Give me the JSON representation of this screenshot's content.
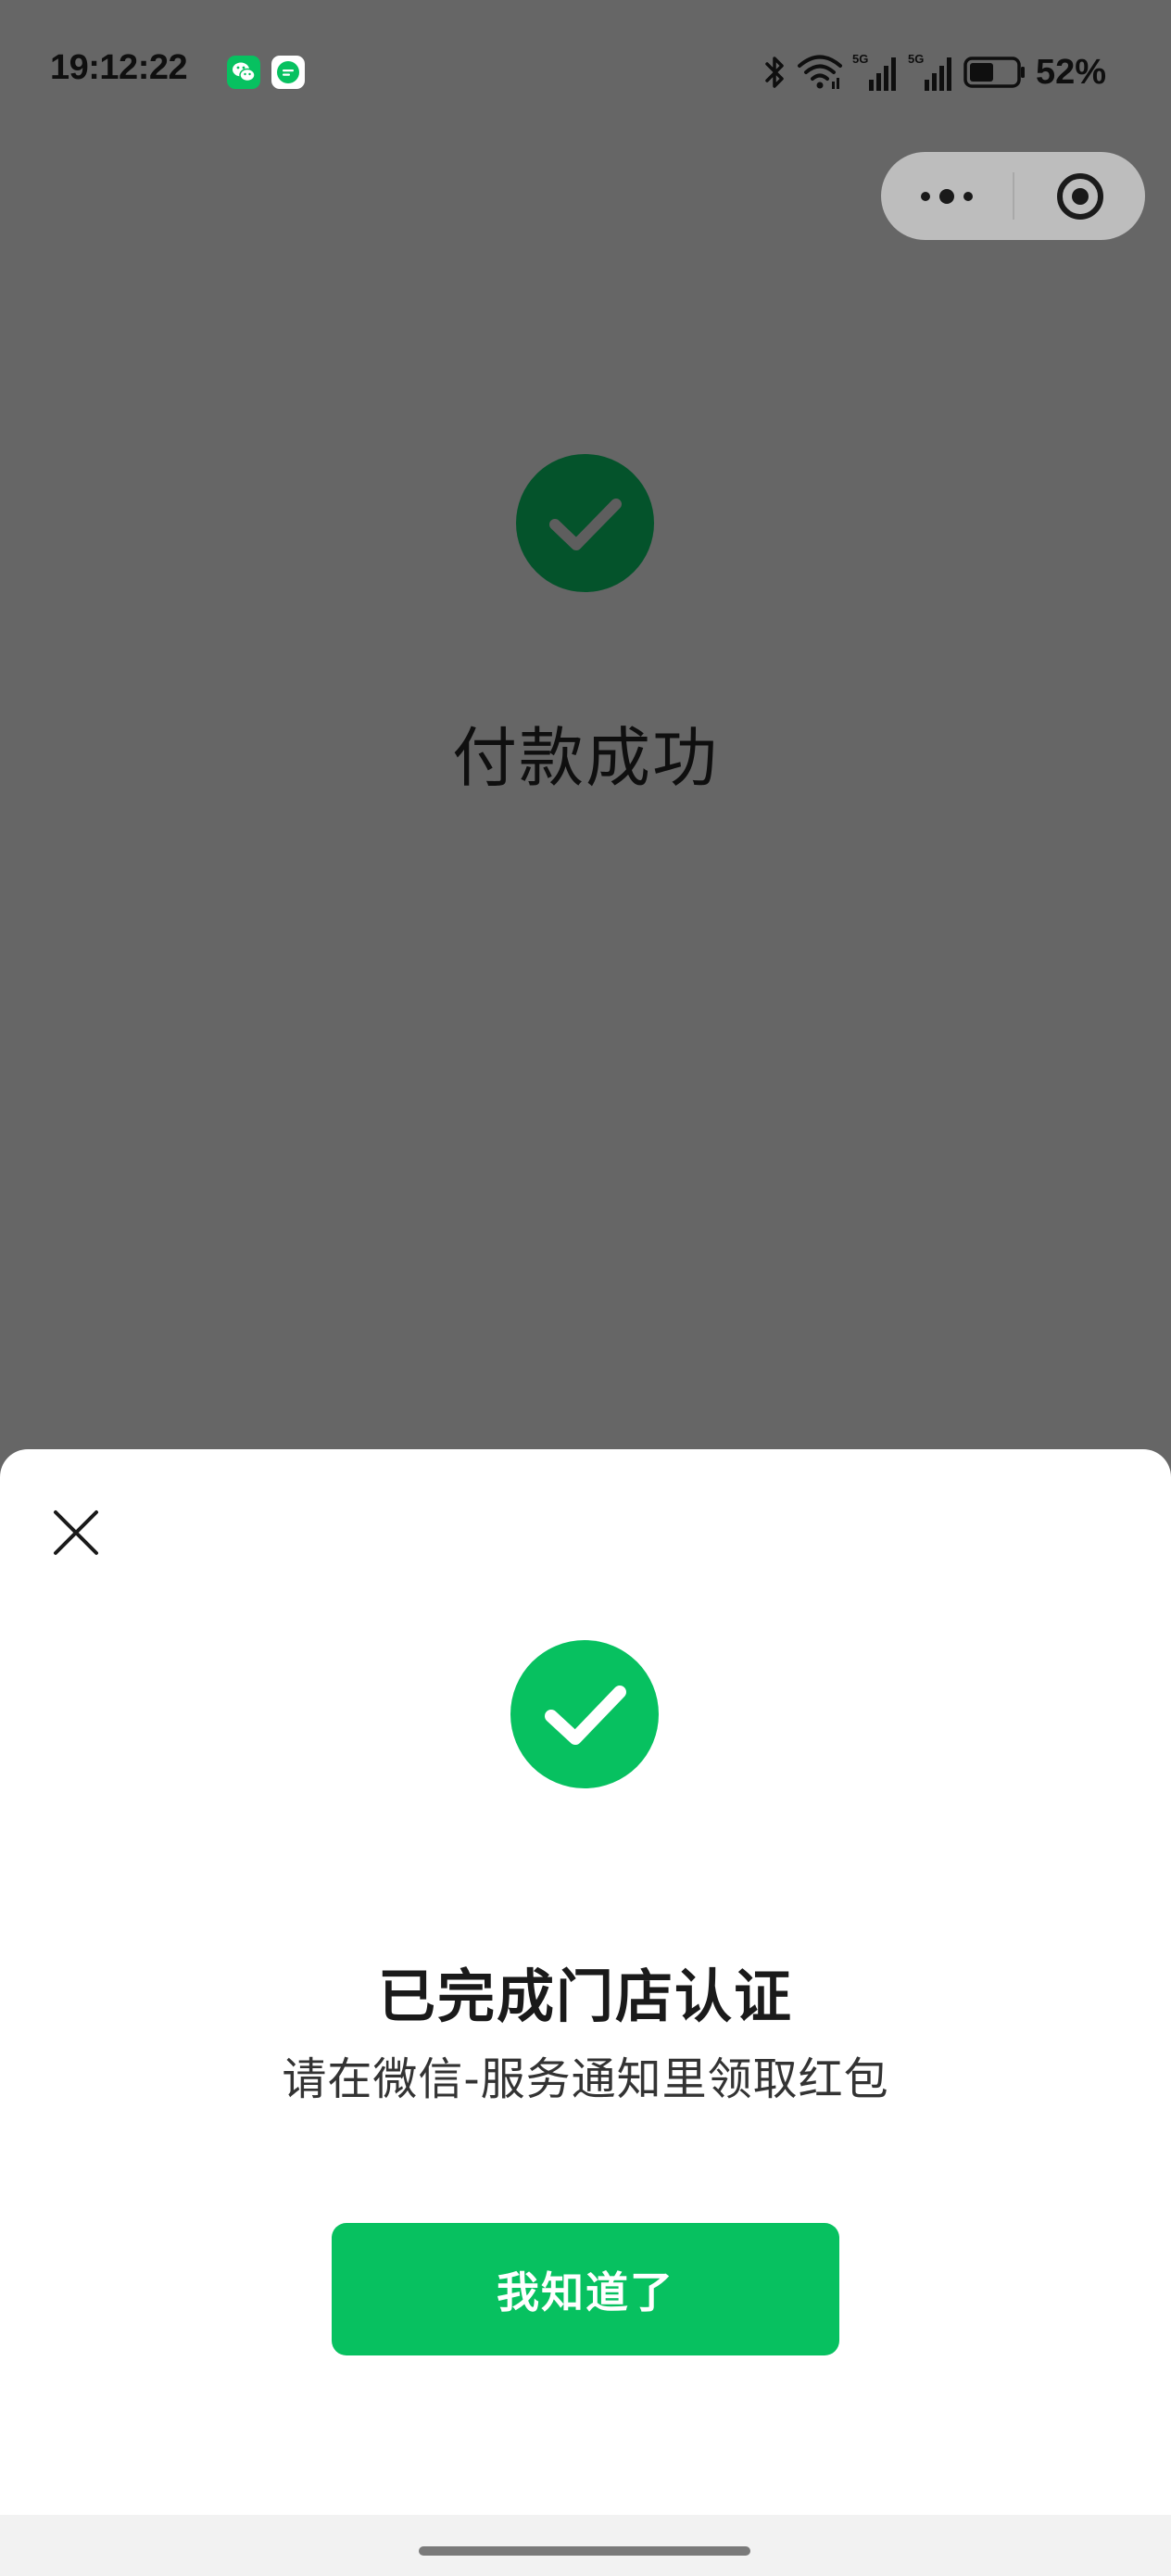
{
  "status_bar": {
    "time": "19:12:22",
    "battery_percent": "52%",
    "notification_icons": [
      "wechat-icon",
      "message-icon"
    ],
    "indicators": [
      "bluetooth-icon",
      "wifi-icon",
      "signal-5g-icon",
      "signal-5g-icon",
      "battery-icon"
    ],
    "battery_level": 0.52
  },
  "capsule": {
    "more_icon": "more-dots-icon",
    "close_icon": "record-circle-icon"
  },
  "background": {
    "success_icon": "check-icon",
    "title": "付款成功"
  },
  "sheet": {
    "close_icon": "close-icon",
    "success_icon": "check-icon",
    "title": "已完成门店认证",
    "subtitle": "请在微信-服务通知里领取红包",
    "confirm_label": "我知道了"
  },
  "colors": {
    "overlay": "#666666",
    "bg_check": "#04532b",
    "accent": "#07c160",
    "sheet_bg": "#ffffff",
    "text": "#1a1a1a"
  }
}
